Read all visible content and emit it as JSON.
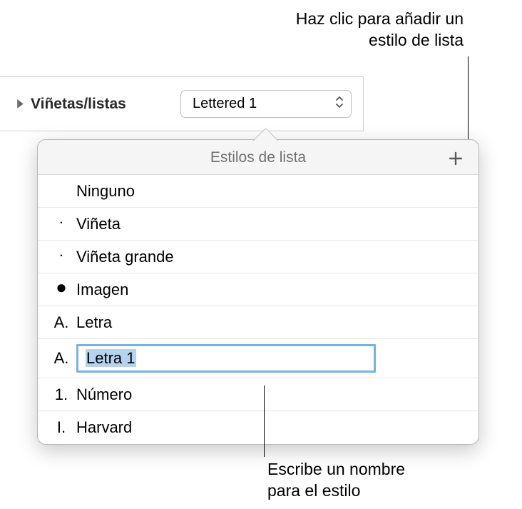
{
  "callouts": {
    "top_line1": "Haz clic para añadir un",
    "top_line2": "estilo de lista",
    "bottom_line1": "Escribe un nombre",
    "bottom_line2": "para el estilo"
  },
  "section": {
    "label": "Viñetas/listas"
  },
  "dropdown": {
    "value": "Lettered 1"
  },
  "popover": {
    "title": "Estilos de lista",
    "items": [
      {
        "marker": "",
        "marker_class": "empty",
        "label": "Ninguno",
        "editing": false
      },
      {
        "marker": "•",
        "marker_class": "small-dot",
        "label": "Viñeta",
        "editing": false
      },
      {
        "marker": "•",
        "marker_class": "small-dot",
        "label": "Viñeta grande",
        "editing": false
      },
      {
        "marker": "●",
        "marker_class": "big-dot",
        "label": "Imagen",
        "editing": false
      },
      {
        "marker": "A.",
        "marker_class": "",
        "label": "Letra",
        "editing": false
      },
      {
        "marker": "A.",
        "marker_class": "",
        "label": "Letra 1",
        "editing": true
      },
      {
        "marker": "1.",
        "marker_class": "",
        "label": "Número",
        "editing": false
      },
      {
        "marker": "I.",
        "marker_class": "",
        "label": "Harvard",
        "editing": false
      }
    ]
  }
}
